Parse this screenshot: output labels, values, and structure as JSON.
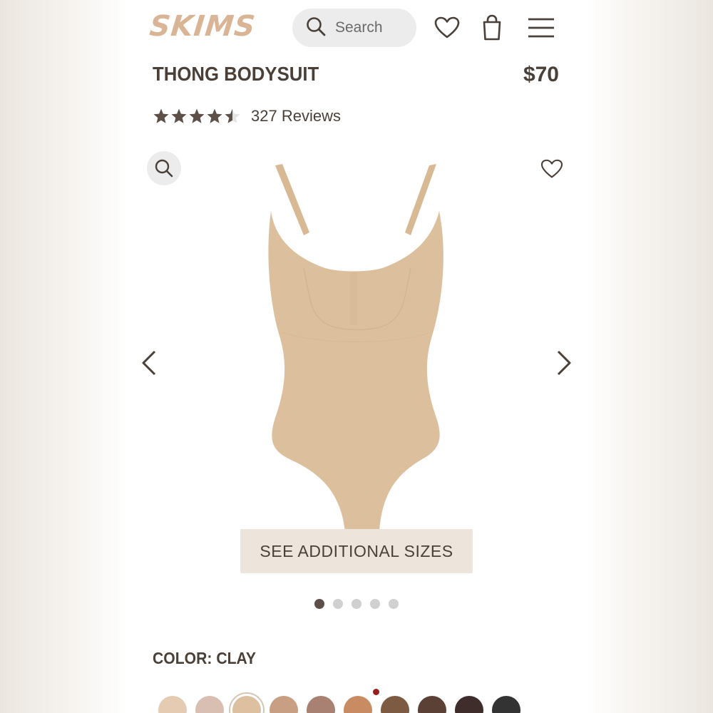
{
  "header": {
    "logo_text": "SKIMS",
    "search_placeholder": "Search",
    "icons": [
      "search-icon",
      "heart-icon",
      "shopping-bag-icon",
      "hamburger-menu-icon"
    ]
  },
  "product": {
    "title": "THONG BODYSUIT",
    "price": "$70",
    "rating": 4.5,
    "reviews_label": "327 Reviews",
    "image_color": "#dcc09d"
  },
  "gallery": {
    "additional_sizes_label": "SEE ADDITIONAL SIZES",
    "image_count": 5,
    "active_index": 0
  },
  "color": {
    "label": "COLOR: CLAY",
    "selected_index": 2,
    "swatches": [
      "#e6cbb3",
      "#d8bfb2",
      "#dcc09f",
      "#c99f83",
      "#a98172",
      "#c98c62",
      "#7d5a42",
      "#5b4036",
      "#3e2d2b",
      "#333333"
    ]
  },
  "theme": {
    "text_color": "#4a4038",
    "logo_color": "#d9b596",
    "button_bg": "#ede4db"
  }
}
